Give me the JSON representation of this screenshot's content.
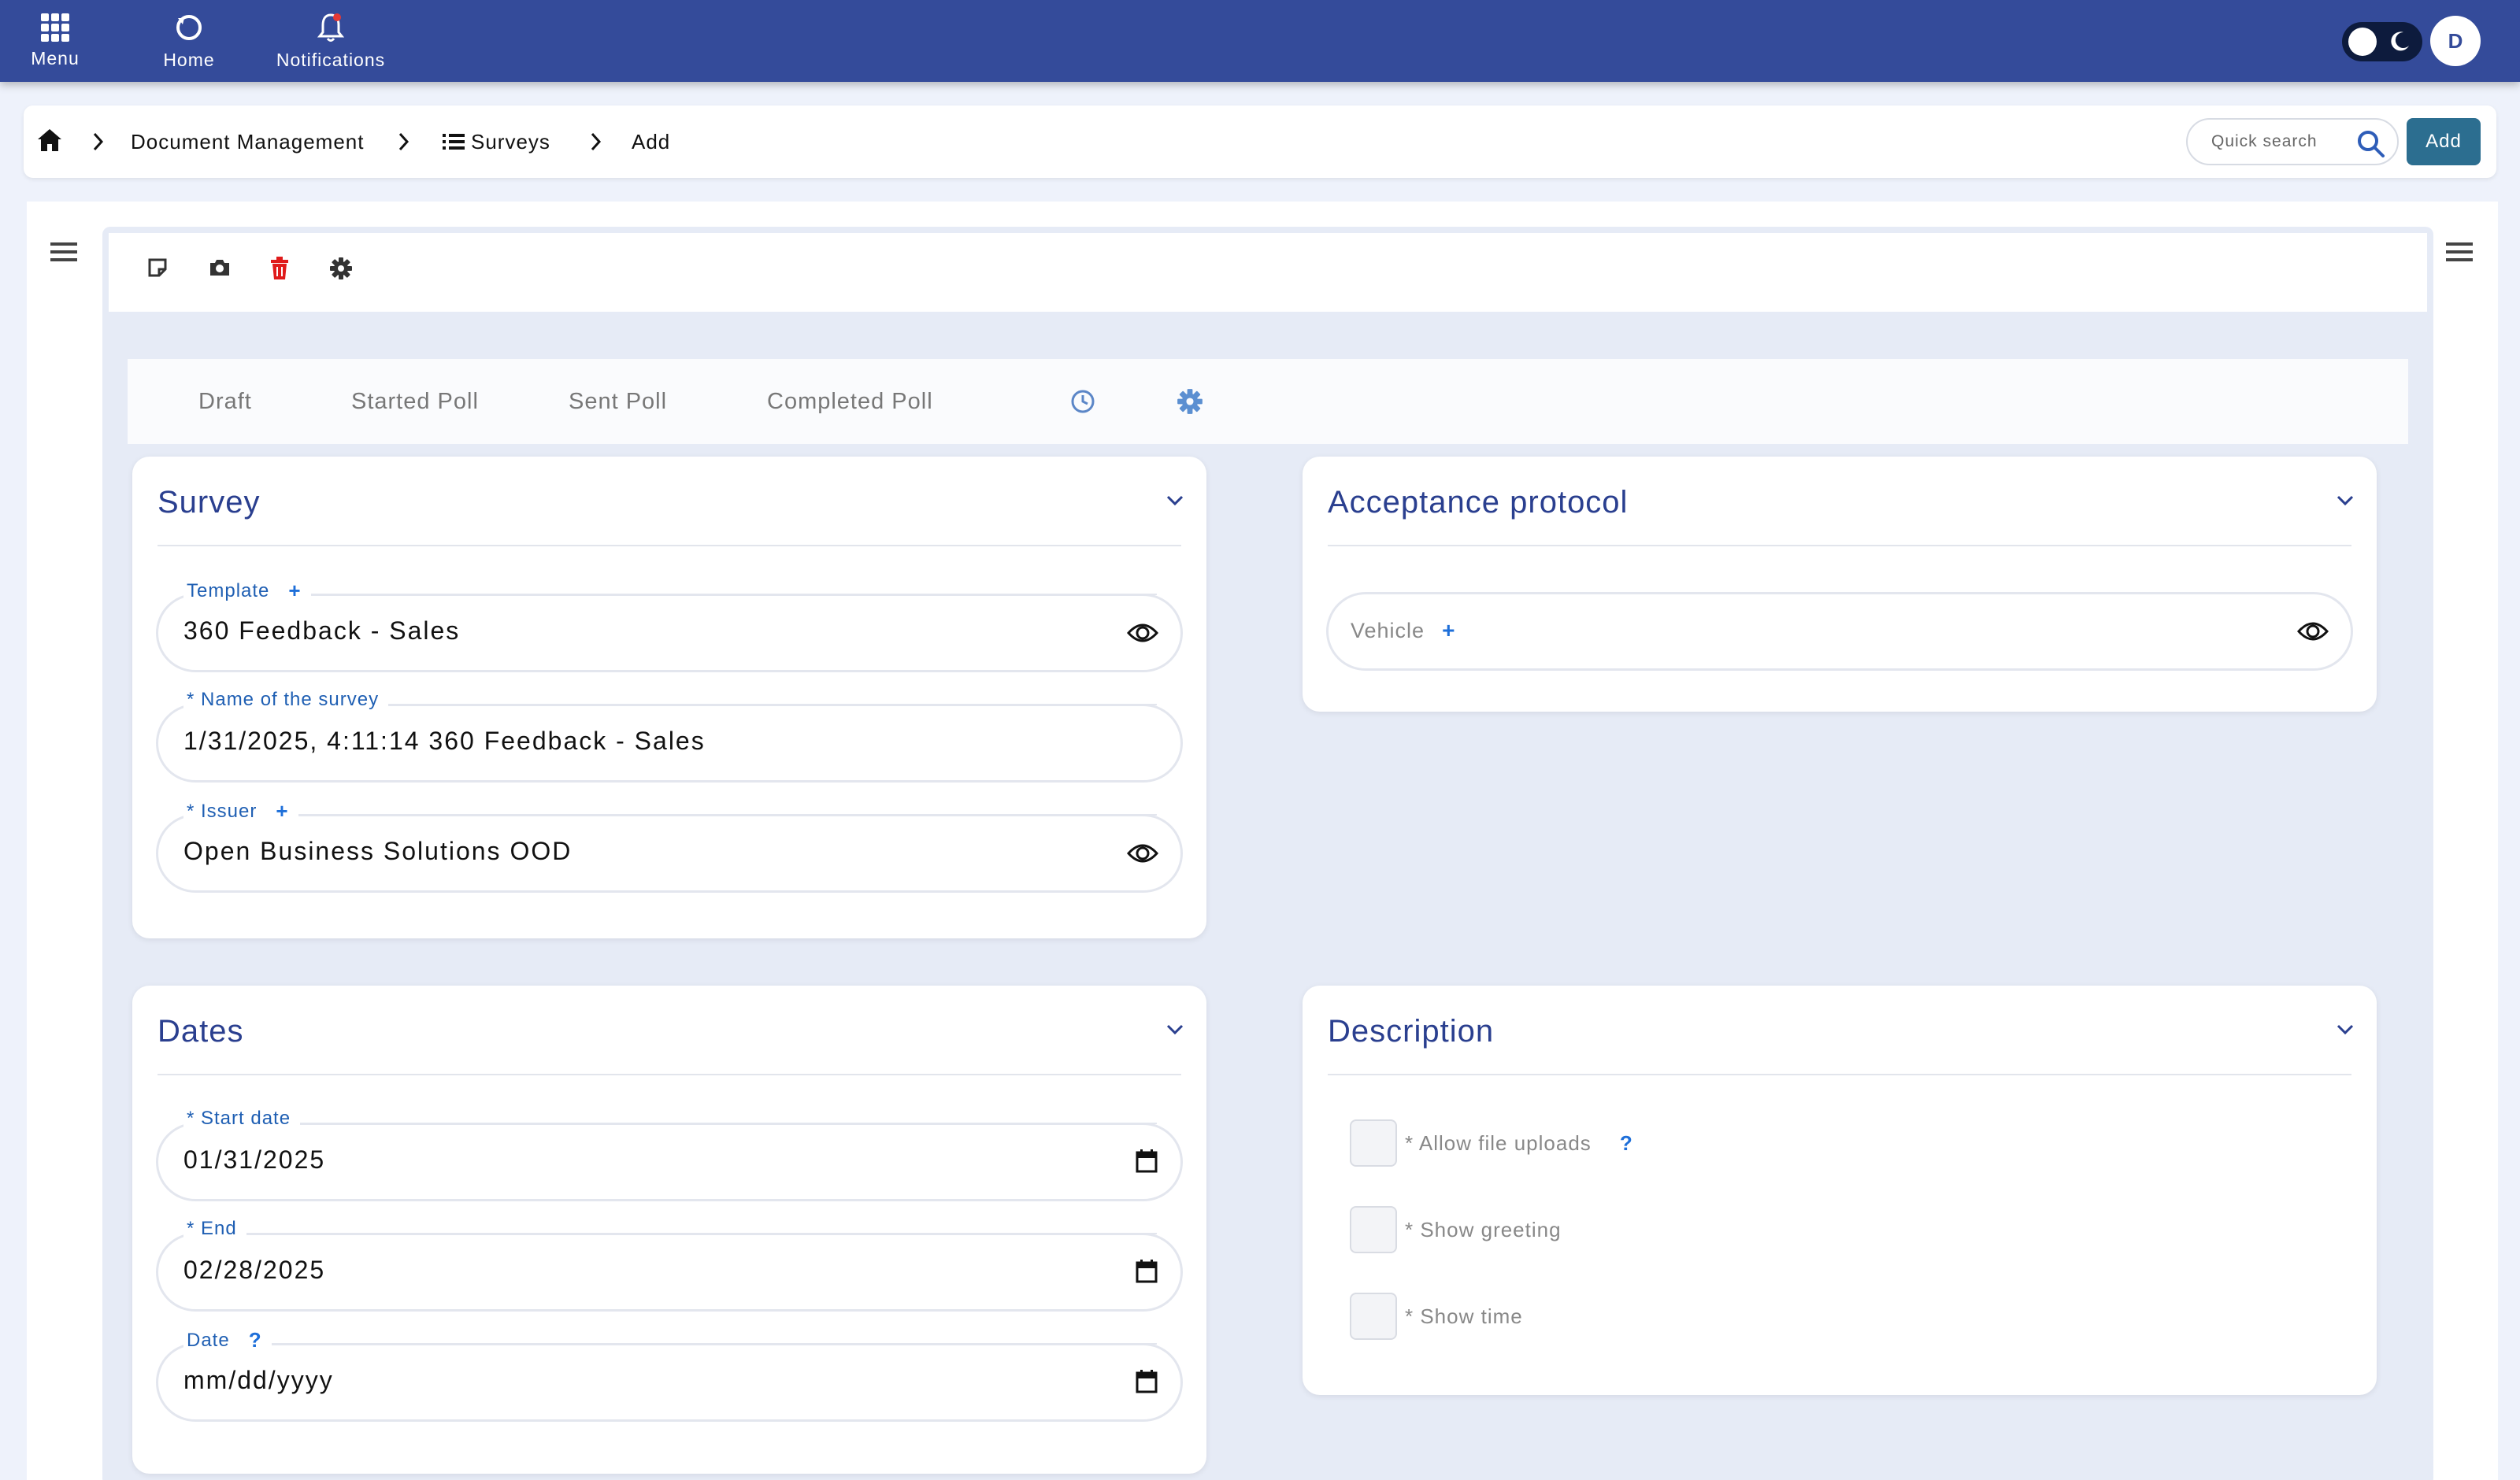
{
  "topbar": {
    "menu_label": "Menu",
    "home_label": "Home",
    "notifications_label": "Notifications",
    "avatar_letter": "D",
    "color": "#344b9a"
  },
  "breadcrumb": {
    "items": [
      "Document Management",
      "Surveys",
      "Add"
    ]
  },
  "search": {
    "placeholder": "Quick search"
  },
  "header_actions": {
    "add_label": "Add",
    "add_color": "#2c6e90"
  },
  "tabs": [
    "Draft",
    "Started Poll",
    "Sent Poll",
    "Completed Poll"
  ],
  "survey_card": {
    "title": "Survey",
    "template": {
      "label": "Template",
      "value": "360 Feedback - Sales"
    },
    "name": {
      "label": "* Name of the survey",
      "value": "1/31/2025, 4:11:14 360 Feedback - Sales"
    },
    "issuer": {
      "label": "* Issuer",
      "value": "Open Business Solutions OOD"
    }
  },
  "acceptance_card": {
    "title": "Acceptance protocol",
    "vehicle": {
      "label": "Vehicle"
    }
  },
  "dates_card": {
    "title": "Dates",
    "start": {
      "label": "* Start date",
      "value": "01/31/2025"
    },
    "end": {
      "label": "* End",
      "value": "02/28/2025"
    },
    "date": {
      "label": "Date",
      "value": "mm/dd/yyyy"
    }
  },
  "description_card": {
    "title": "Description",
    "checkboxes": [
      {
        "label": "* Allow file uploads",
        "checked": false
      },
      {
        "label": "* Show greeting",
        "checked": false
      },
      {
        "label": "* Show time",
        "checked": false
      }
    ]
  },
  "icons": {
    "menu": "grid-icon",
    "home": "refresh-home-icon",
    "notifications": "bell-icon",
    "theme": "moon-icon",
    "search": "search-icon",
    "view": "eye-icon",
    "calendar": "calendar-icon",
    "delete": "trash-icon",
    "settings": "gear-icon",
    "note": "note-icon",
    "camera": "camera-icon",
    "history": "clock-icon"
  }
}
